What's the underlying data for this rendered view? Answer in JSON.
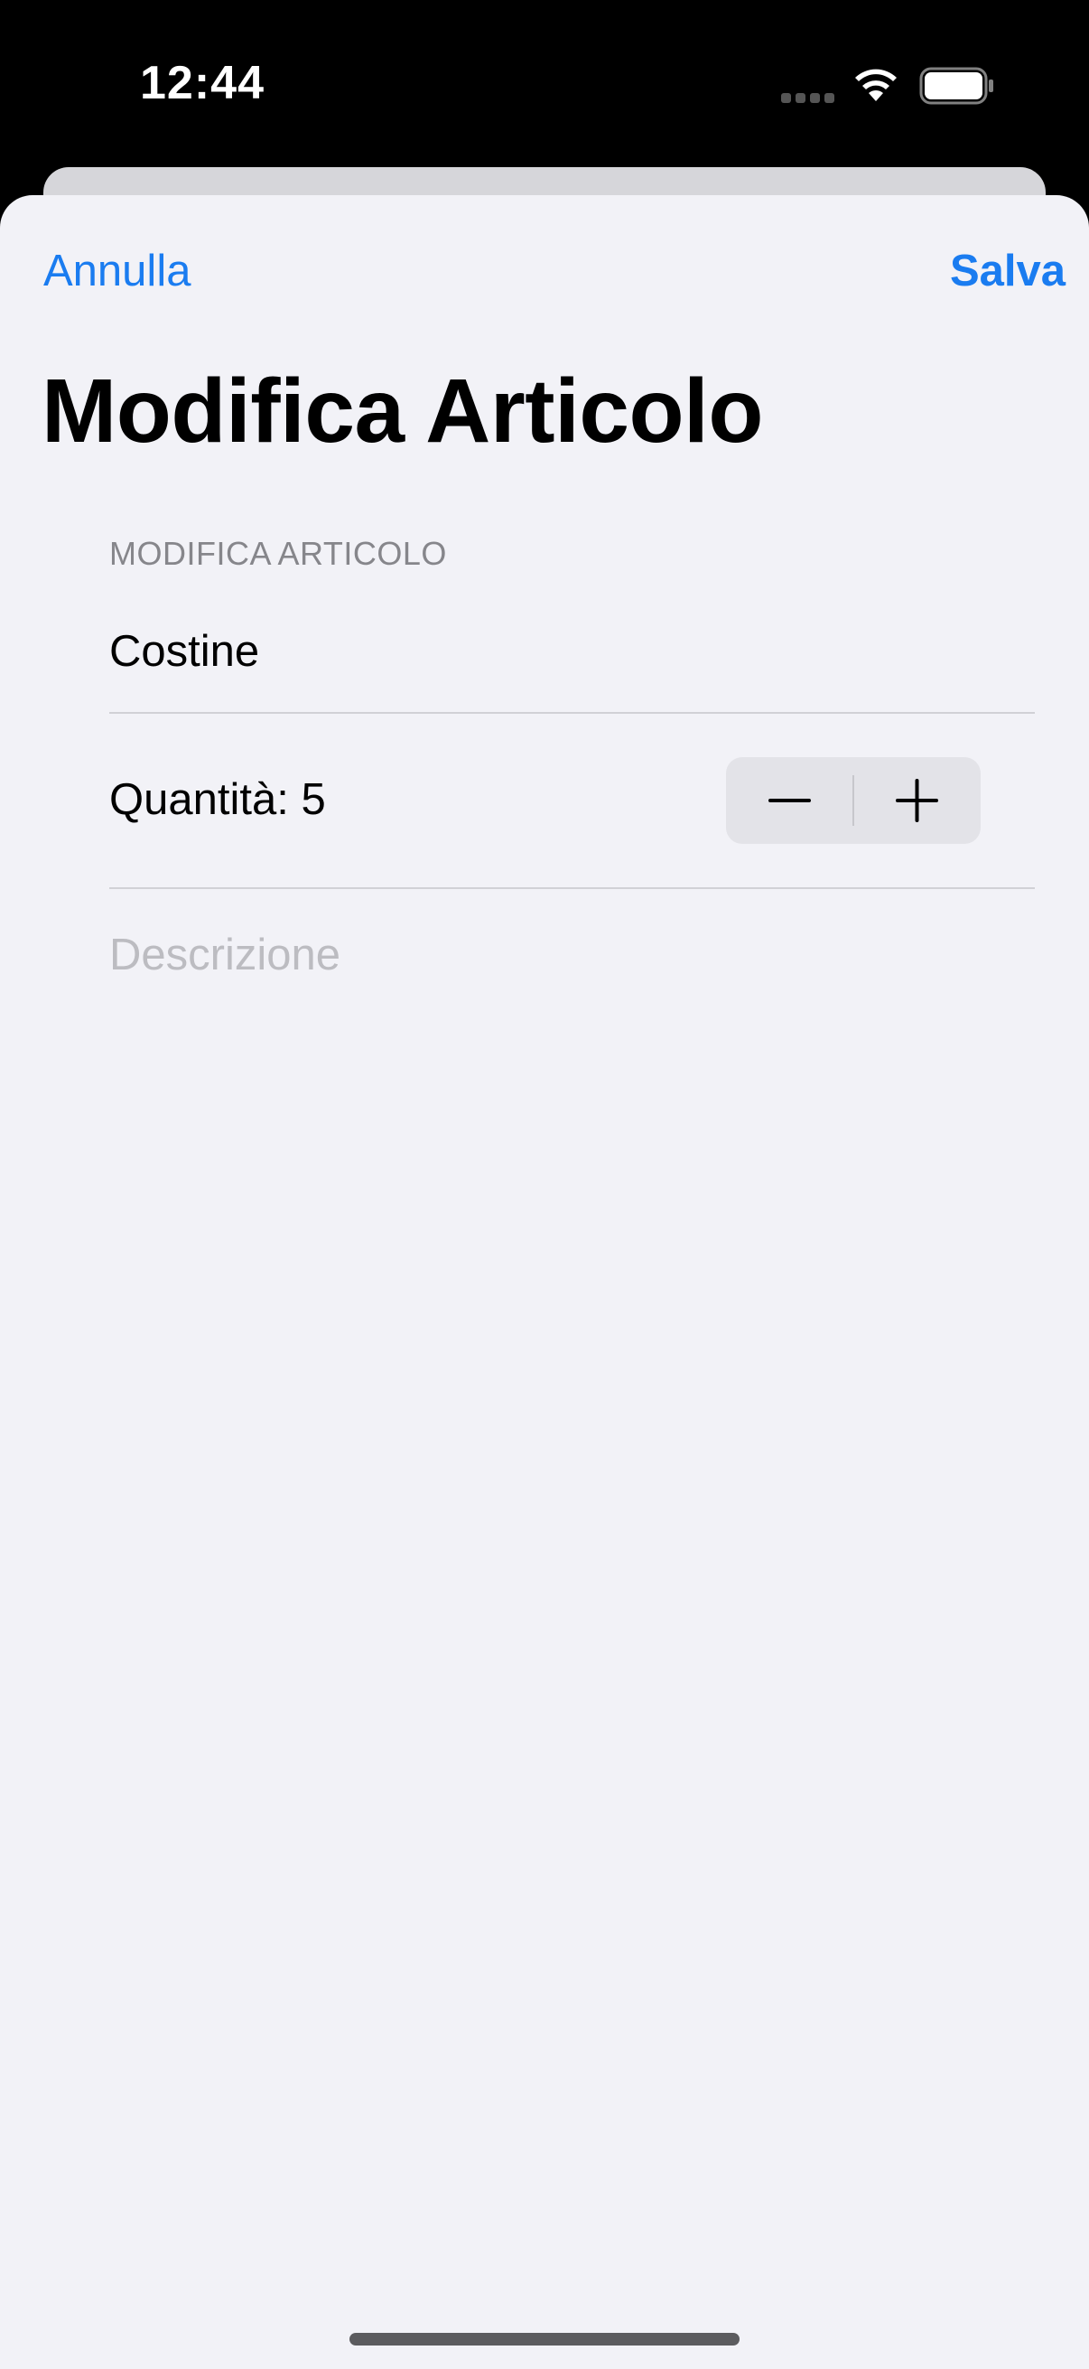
{
  "status_bar": {
    "time": "12:44",
    "signal_icon": "signal-dots-icon",
    "wifi_icon": "wifi-icon",
    "battery_icon": "battery-icon"
  },
  "nav": {
    "cancel_label": "Annulla",
    "save_label": "Salva"
  },
  "page": {
    "title": "Modifica Articolo"
  },
  "form": {
    "section_header": "MODIFICA ARTICOLO",
    "name_value": "Costine",
    "quantity_label": "Quantità: 5",
    "quantity": 5,
    "description_value": "",
    "description_placeholder": "Descrizione"
  },
  "stepper": {
    "minus_icon": "minus-icon",
    "plus_icon": "plus-icon"
  },
  "colors": {
    "accent": "#1a7cf0",
    "background": "#f2f2f7",
    "section_header": "#86868b",
    "placeholder": "#bcbcc1",
    "separator": "#d1d1d6"
  }
}
